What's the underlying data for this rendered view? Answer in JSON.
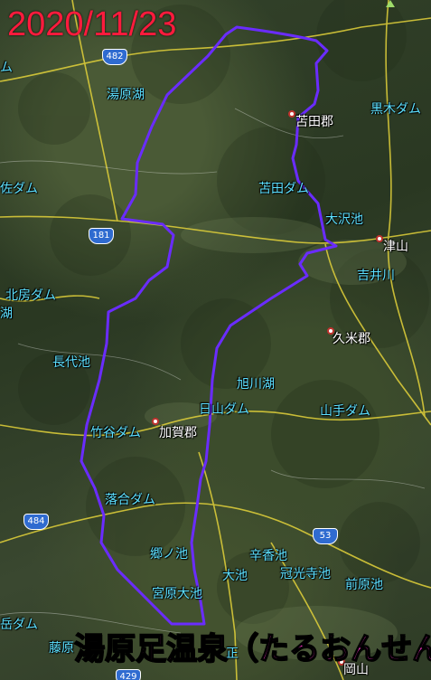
{
  "date": "2020/11/23",
  "caption": "湯原足温泉（たるおんせん）",
  "route_color": "#6a2cff",
  "label_color": "#5ce0ff",
  "places": [
    {
      "id": "yubara-ko",
      "text": "湯原湖",
      "type": "water"
    },
    {
      "id": "tomata-gun",
      "text": "苫田郡",
      "type": "town"
    },
    {
      "id": "kuroki-dam",
      "text": "黒木ダム",
      "type": "water"
    },
    {
      "id": "tomata-dam",
      "text": "苫田ダム",
      "type": "water"
    },
    {
      "id": "osawa-ike",
      "text": "大沢池",
      "type": "water"
    },
    {
      "id": "tsuyama",
      "text": "津山",
      "type": "town"
    },
    {
      "id": "yoshii-gawa",
      "text": "吉井川",
      "type": "water"
    },
    {
      "id": "sa-dam",
      "text": "佐ダム",
      "type": "water"
    },
    {
      "id": "kitabo-dam",
      "text": "北房ダム",
      "type": "water"
    },
    {
      "id": "kume-gun",
      "text": "久米郡",
      "type": "town"
    },
    {
      "id": "nagashiro-ike",
      "text": "長代池",
      "type": "water"
    },
    {
      "id": "asahikawa-ko",
      "text": "旭川湖",
      "type": "water"
    },
    {
      "id": "hiyama-dam",
      "text": "日山ダム",
      "type": "water"
    },
    {
      "id": "yamate-dam",
      "text": "山手ダム",
      "type": "water"
    },
    {
      "id": "takeya-dam",
      "text": "竹谷ダム",
      "type": "water"
    },
    {
      "id": "kaga-gun",
      "text": "加賀郡",
      "type": "town"
    },
    {
      "id": "ochiai-dam",
      "text": "落合ダム",
      "type": "water"
    },
    {
      "id": "gono-ike",
      "text": "郷ノ池",
      "type": "water"
    },
    {
      "id": "shinko-ike",
      "text": "辛香池",
      "type": "water"
    },
    {
      "id": "oike",
      "text": "大池",
      "type": "water"
    },
    {
      "id": "kankoji-ike",
      "text": "冠光寺池",
      "type": "water"
    },
    {
      "id": "mae-hara-ike",
      "text": "前原池",
      "type": "water"
    },
    {
      "id": "miyahara-oike",
      "text": "宮原大池",
      "type": "water"
    },
    {
      "id": "hashi-dam",
      "text": "岳ダム",
      "type": "water"
    },
    {
      "id": "fujihara",
      "text": "藤原",
      "type": "water"
    },
    {
      "id": "okayama",
      "text": "岡山",
      "type": "town"
    },
    {
      "id": "sho",
      "text": "正",
      "type": "water"
    },
    {
      "id": "left-dam",
      "text": "ム",
      "type": "water"
    },
    {
      "id": "left-lake",
      "text": "湖",
      "type": "water"
    }
  ],
  "road_shields": [
    {
      "id": "r482",
      "text": "482"
    },
    {
      "id": "r181",
      "text": "181"
    },
    {
      "id": "r484",
      "text": "484"
    },
    {
      "id": "r53",
      "text": "53"
    },
    {
      "id": "r429",
      "text": "429"
    }
  ]
}
